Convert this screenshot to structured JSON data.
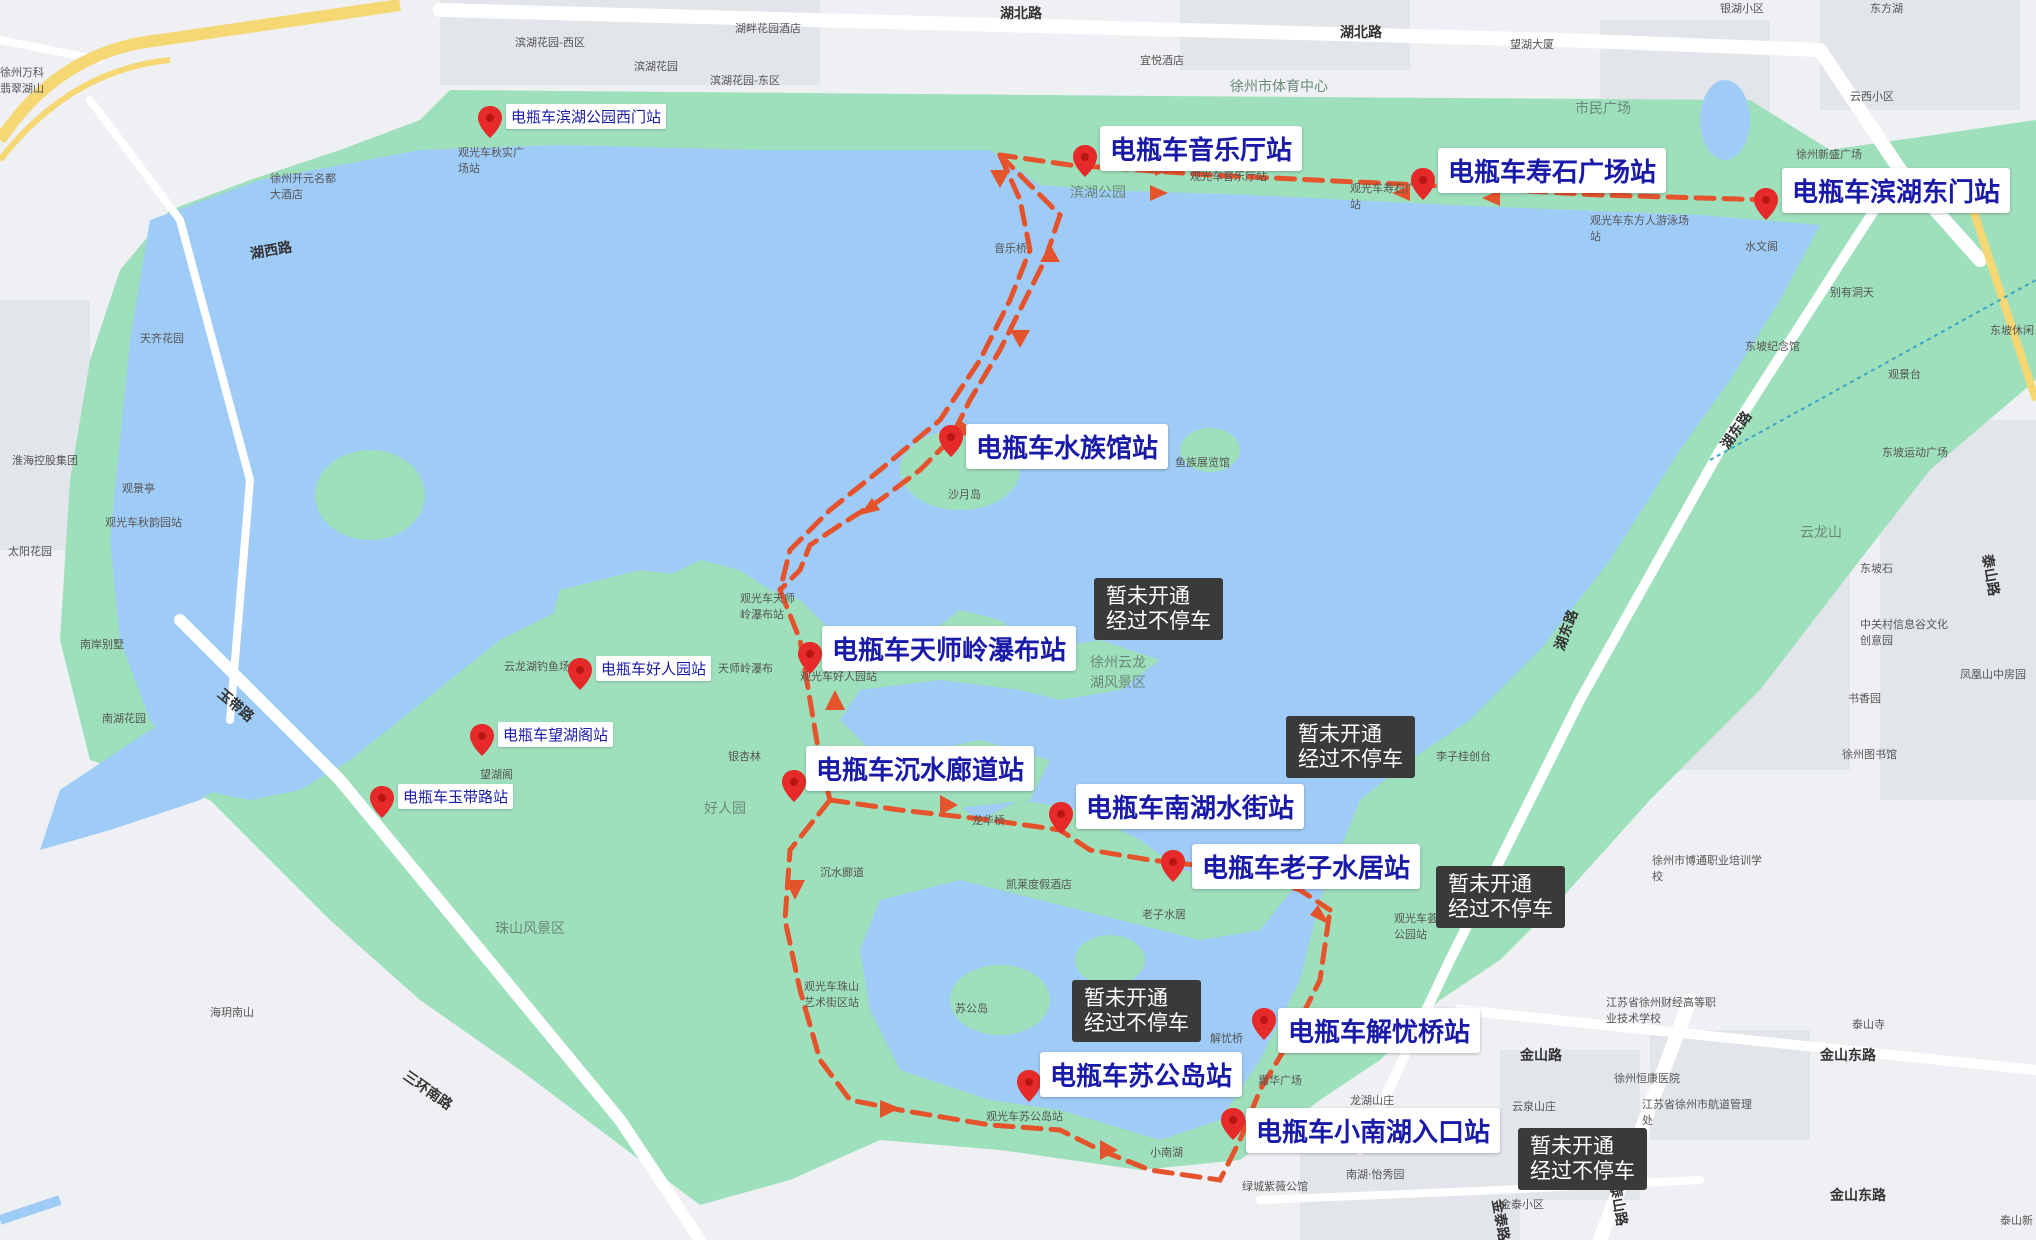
{
  "map": {
    "colors": {
      "water": "#9fcbf7",
      "park": "#9fe0bc",
      "road": "#ffffff",
      "highway": "#f5d774",
      "route": "#e5532c",
      "pin": "#e62a2a",
      "label_text": "#1a1aa8",
      "note_bg": "#3a3a3a"
    },
    "streets": [
      "湖北路",
      "湖北路",
      "湖西路",
      "玉带路",
      "三环南路",
      "湖东路",
      "湖东路",
      "泰山路",
      "泰山路",
      "金山东路",
      "金山东路",
      "金山路",
      "金泰路"
    ],
    "areas": [
      "徐州市体育中心",
      "市民广场",
      "滨湖公园",
      "云龙山",
      "珠山风景区",
      "好人园",
      "徐州云龙湖风景区"
    ],
    "pois": [
      "滨湖花园-西区",
      "湖畔花园酒店",
      "滨湖花园",
      "滨湖花园-东区",
      "宜悦酒店",
      "望湖大厦",
      "银湖小区",
      "东方湖",
      "徐州万科翡翠湖山",
      "徐州开元名都大酒店",
      "天齐花园",
      "淮海控股集团",
      "观景亭",
      "观光车秋韵园站",
      "太阳花园",
      "南岸别墅",
      "南湖花园",
      "观光车秋实广场站",
      "观光车音乐厅站",
      "观光车寿石广场站",
      "观光车东方人游泳场站",
      "音乐桥",
      "水文阁",
      "云西小区",
      "徐州新盛广场",
      "别有洞天",
      "东坡纪念馆",
      "观景台",
      "东坡休闲",
      "东坡运动广场",
      "沙月岛",
      "鱼族展览馆",
      "观光车天师岭瀑布站",
      "天师岭瀑布",
      "云龙湖钓鱼场",
      "银杏林",
      "望湖阁",
      "观光车好人园站",
      "东坡石",
      "中关村信息谷文化创意园",
      "凤凰山中房园",
      "书香园",
      "徐州图书馆",
      "李子桂创台",
      "龙华桥",
      "凯莱度假酒店",
      "老子水居",
      "观光车荟水公园站",
      "徐州市博通职业培训学校",
      "江苏省徐州财经高等职业技术学校",
      "泰山寺",
      "沉水廊道",
      "观光车珠山艺术街区站",
      "海玥南山",
      "苏公岛",
      "解忧桥",
      "嘉华广场",
      "龙湖山庄",
      "云泉山庄",
      "观光车苏公岛站",
      "小南湖",
      "绿城紫薇公馆",
      "南湖·怡秀园",
      "金泰小区",
      "徐州恒康医院",
      "江苏省徐州市航道管理处",
      "泰山新"
    ],
    "stations_major": [
      "电瓶车音乐厅站",
      "电瓶车寿石广场站",
      "电瓶车滨湖东门站",
      "电瓶车水族馆站",
      "电瓶车天师岭瀑布站",
      "电瓶车沉水廊道站",
      "电瓶车南湖水街站",
      "电瓶车老子水居站",
      "电瓶车解忧桥站",
      "电瓶车苏公岛站",
      "电瓶车小南湖入口站"
    ],
    "stations_minor": [
      "电瓶车滨湖公园西门站",
      "电瓶车好人园站",
      "电瓶车望湖阁站",
      "电瓶车玉带路站"
    ],
    "notes": [
      {
        "line1": "暂未开通",
        "line2": "经过不停车"
      },
      {
        "line1": "暂未开通",
        "line2": "经过不停车"
      },
      {
        "line1": "暂未开通",
        "line2": "经过不停车"
      },
      {
        "line1": "暂未开通",
        "line2": "经过不停车"
      },
      {
        "line1": "暂未开通",
        "line2": "经过不停车"
      }
    ]
  }
}
